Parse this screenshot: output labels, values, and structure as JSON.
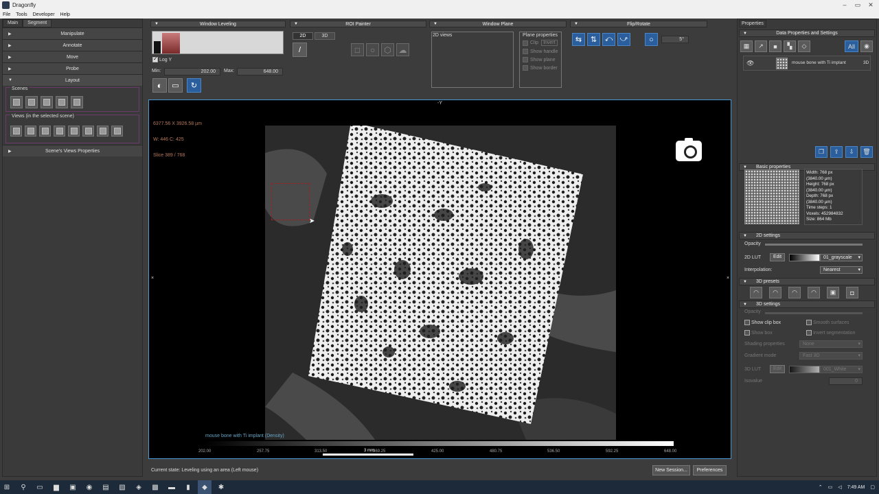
{
  "window": {
    "title": "Dragonfly"
  },
  "menu": [
    "File",
    "Tools",
    "Developer",
    "Help"
  ],
  "left": {
    "tabs": [
      "Main",
      "Segment"
    ],
    "sections": [
      "Manipulate",
      "Annotate",
      "Move",
      "Probe",
      "Layout"
    ],
    "scenes_label": "Scenes",
    "views_label": "Views (in the selected scene)",
    "scene_views_props": "Scene's Views Properties"
  },
  "toolbar": {
    "window_leveling": "Window Leveling",
    "log_label": "Log Y",
    "min_label": "Min:",
    "min_value": "202.00",
    "max_label": "Max:",
    "max_value": "648.00",
    "roi_painter": "ROI Painter",
    "mode_2d": "2D",
    "mode_3d": "3D",
    "window_plane": "Window Plane",
    "views_2d": "2D views",
    "plane_properties": "Plane properties",
    "plane_opts": [
      "Clip",
      "Show handle",
      "Show plane",
      "Show border"
    ],
    "invert": "Invert",
    "flip_rotate": "Flip/Rotate",
    "rotate_angle": "5°"
  },
  "viewport": {
    "info1": "6377.56 X 3926.58 µm",
    "info2": "W: 446 C: 425",
    "info3": "Slice 389 / 768",
    "top_axis": "-Y",
    "dataset_label": "mouse bone with Ti implant (Density)",
    "scale": "3 mm",
    "ticks": [
      "202.00",
      "257.75",
      "313.50",
      "369.25",
      "425.00",
      "480.75",
      "536.50",
      "592.25",
      "648.00"
    ]
  },
  "status": {
    "text": "Current state: Leveling using an area (Left mouse)",
    "new_session": "New Session...",
    "preferences": "Preferences"
  },
  "right": {
    "tab": "Properties",
    "data_props": "Data Properties and Settings",
    "all": "All",
    "object_name": "mouse bone with Ti implant",
    "object_mode": "3D",
    "basic_props": "Basic properties",
    "info_lines": [
      "Width: 768 px",
      "(3840.00 µm)",
      "Height: 768 px",
      "(3840.00 µm)",
      "Depth: 768 px",
      "(3840.00 µm)",
      "Time steps: 1",
      "Voxels: 452984832",
      "Size: 864 Mb"
    ],
    "settings_2d": "2D settings",
    "opacity": "Opacity",
    "lut_2d": "2D LUT",
    "edit": "Edit",
    "lut_name": "01_grayscale",
    "interpolation": "Interpolation:",
    "interp_value": "Nearest",
    "presets_3d": "3D presets",
    "settings_3d": "3D settings",
    "opacity3d": "Opacity",
    "show_clip_box": "Show clip box",
    "smooth_surfaces": "Smooth surfaces",
    "show_box": "Show box",
    "invert_seg": "Invert segmentation",
    "shading": "Shading properties",
    "shading_val": "None",
    "gradient": "Gradient mode",
    "gradient_val": "Fast 3D",
    "lut_3d": "3D LUT",
    "lut3d_name": "001_White",
    "isovalue": "Isovalue"
  },
  "taskbar": {
    "time": "7:49 AM"
  }
}
